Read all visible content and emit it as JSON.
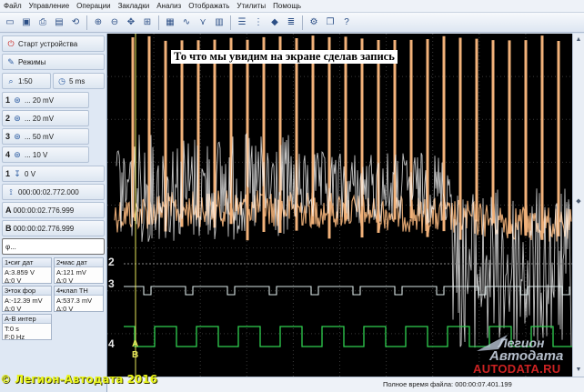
{
  "menu": {
    "items": [
      "Файл",
      "Управление",
      "Операции",
      "Закладки",
      "Анализ",
      "Отображать",
      "Утилиты",
      "Помощь"
    ]
  },
  "toolbar": {
    "icons": [
      "file-icon",
      "save-icon",
      "print-icon",
      "image-icon",
      "reopen-icon",
      "zoom-in-icon",
      "zoom-out-icon",
      "cursor-icon",
      "measure-icon",
      "grid-icon",
      "sine-icon",
      "filter-icon",
      "chart-icon",
      "layers-icon",
      "channels-icon",
      "marker-icon",
      "list-icon",
      "settings-icon",
      "window-icon",
      "help-icon"
    ]
  },
  "left_panel": {
    "start_label": "Старт устройства",
    "modes_label": "Режимы",
    "scale_label": "1:50",
    "timebase_label": "5 ms",
    "channels": [
      {
        "num": "1",
        "value": "... 20 mV"
      },
      {
        "num": "2",
        "value": "... 20 mV"
      },
      {
        "num": "3",
        "value": "... 50 mV"
      },
      {
        "num": "4",
        "value": "... 10 V"
      }
    ],
    "trigger_row": {
      "num": "1",
      "value": "0 V"
    },
    "delay_value": "000:00:02.772.000",
    "cursor_a": {
      "label": "A",
      "value": "000:00:02.776.999"
    },
    "cursor_b": {
      "label": "B",
      "value": "000:00:02.776.999"
    },
    "phi_label": "φ...",
    "cells": [
      {
        "head": "1•сиг дат",
        "line1": "A:3.859 V",
        "line2": "Δ:0 V"
      },
      {
        "head": "2•мас дат",
        "line1": "A:121 mV",
        "line2": "Δ:0 V"
      },
      {
        "head": "3•ток фор",
        "line1": "A:-12.39 mV",
        "line2": "Δ:0 V"
      },
      {
        "head": "4•клап ТН",
        "line1": "A:537.3 mV",
        "line2": "Δ:0 V"
      }
    ],
    "ab_cell": {
      "head": "A-B интер",
      "line1": "T:0 s",
      "line2": "F:0 Hz"
    }
  },
  "scope": {
    "title": "То что мы увидим на экране сделав запись",
    "trace_labels": [
      "2",
      "3",
      "4",
      "A",
      "B"
    ],
    "colors": {
      "background": "#000000",
      "grid": "#3a3a3a",
      "ch1": "#f2b27a",
      "ch2": "#ffffff",
      "ch3": "#d9e6e6",
      "ch4": "#30d050"
    }
  },
  "status": {
    "file_time": "Полное время файла: 000:00:07.401.199"
  },
  "watermarks": {
    "left": "© Легион-Автодата 2016",
    "logo_line1": "Легион",
    "logo_line2": "Автодата",
    "url": "AUTODATA.RU"
  }
}
